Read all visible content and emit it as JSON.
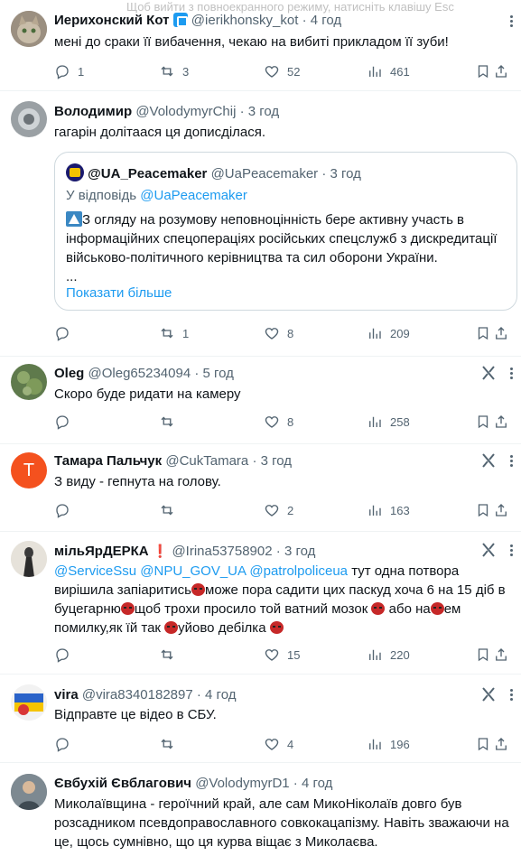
{
  "banner": "Щоб вийти з повноекранного режиму, натисніть клавішу Esc",
  "tweets": [
    {
      "name": "Иерихонский Кот",
      "handle": "@ierikhonsky_kot",
      "time": "4 год",
      "text": "мені до сраки її вибачення, чекаю на вибиті прикладом її зуби!",
      "replies": "1",
      "reposts": "3",
      "likes": "52",
      "views": "461"
    },
    {
      "name": "Володимир",
      "handle": "@VolodymyrChij",
      "time": "3 год",
      "text": "гагарін долітаася ця дописділася.",
      "quote": {
        "name": "@UA_Peacemaker",
        "handle": "@UaPeacemaker",
        "time": "3 год",
        "reply_prefix": "У відповідь",
        "reply_to": "@UaPeacemaker",
        "text": "З огляду на розумову неповноцінність бере активну участь в інформаційних спецопераціях російських спецслужб з дискредитації військово-політичного керівництва та сил оборони України.",
        "ellipsis": "...",
        "show_more": "Показати більше"
      },
      "replies": "",
      "reposts": "1",
      "likes": "8",
      "views": "209"
    },
    {
      "name": "Oleg",
      "handle": "@Oleg65234094",
      "time": "5 год",
      "text": "Скоро буде ридати на камеру",
      "replies": "",
      "reposts": "",
      "likes": "8",
      "views": "258"
    },
    {
      "name": "Тамара Пальчук",
      "handle": "@CukTamara",
      "time": "3 год",
      "avatar_letter": "T",
      "text": "З виду - гепнута на голову.",
      "replies": "",
      "reposts": "",
      "likes": "2",
      "views": "163"
    },
    {
      "name": "мільЯрДЕРКА",
      "handle": "@Irina53758902",
      "time": "3 год",
      "mentions": [
        "@ServiceSsu",
        "@NPU_GOV_UA",
        "@patrolpoliceua"
      ],
      "text_1": "тут одна потвора вирішила запіаритись",
      "text_2": "може пора садити цих паскуд хоча 6 на 15 діб в буцегарню",
      "text_3": "щоб трохи просило той ватний мозок",
      "text_4": "або на",
      "text_5": "ем помилку,як їй так",
      "text_6": "уйово",
      "text_7": "дебілка",
      "replies": "",
      "reposts": "",
      "likes": "15",
      "views": "220"
    },
    {
      "name": "vira",
      "handle": "@vira8340182897",
      "time": "4 год",
      "text": "Відправте це відео в СБУ.",
      "replies": "",
      "reposts": "",
      "likes": "4",
      "views": "196"
    },
    {
      "name": "Євбухій Євблагович",
      "handle": "@VolodymyrD1",
      "time": "4 год",
      "text": "Миколаївщина - героїчний край, але сам МикоНіколаїв довго був розсадником псевдоправославного совкокацапізму. Навіть зважаючи на це, щось сумнівно, що ця курва віщає з Миколаєва."
    }
  ],
  "separator": "·",
  "colors": {
    "accent": "#1d9bf0",
    "muted": "#536471",
    "text": "#0f1419",
    "border": "#eff3f4"
  }
}
